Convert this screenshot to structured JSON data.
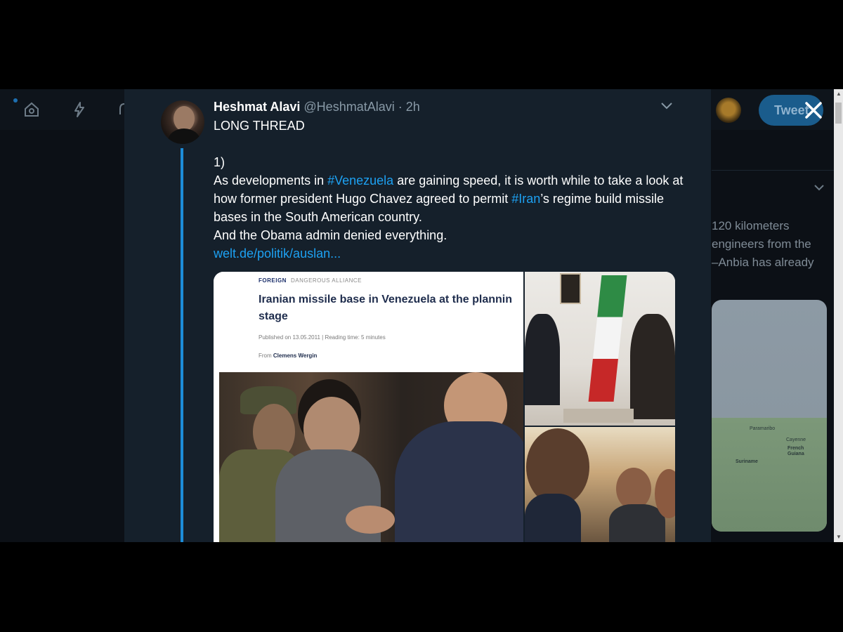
{
  "background_app": {
    "tweet_button_label": "Tweet",
    "trend_text_lines": [
      "120 kilometers",
      "engineers from the",
      "–Anbia has already"
    ],
    "map_labels": [
      "Paramaribo",
      "Suriname",
      "French Guiana",
      "Cayenne"
    ]
  },
  "tweet": {
    "author_name": "Heshmat Alavi",
    "author_handle": "@HeshmatAlavi",
    "separator": "·",
    "time": "2h",
    "line1": "LONG THREAD",
    "line2": "1)",
    "para_before_1": "As developments in ",
    "hashtag_venezuela": "#Venezuela",
    "para_mid": " are gaining speed, it is worth while to take a look at how former president Hugo Chavez agreed to permit ",
    "hashtag_iran": "#Iran",
    "para_after": "’s regime build missile bases in the South American country.",
    "line_obama": "And the Obama admin denied everything.",
    "link_text": "welt.de/politik/auslan..."
  },
  "article_card": {
    "category": "FOREIGN",
    "subcategory": "DANGEROUS ALLIANCE",
    "title_line1": "Iranian missile base in Venezuela at the plannin",
    "title_line2": "stage",
    "meta": "Published on 13.05.2011 | Reading time: 5 minutes",
    "by_prefix": "From ",
    "author": "Clemens Wergin"
  },
  "colors": {
    "modal_bg": "#15202b",
    "link_blue": "#1da1f2",
    "thread_line": "#1d8cd8"
  }
}
